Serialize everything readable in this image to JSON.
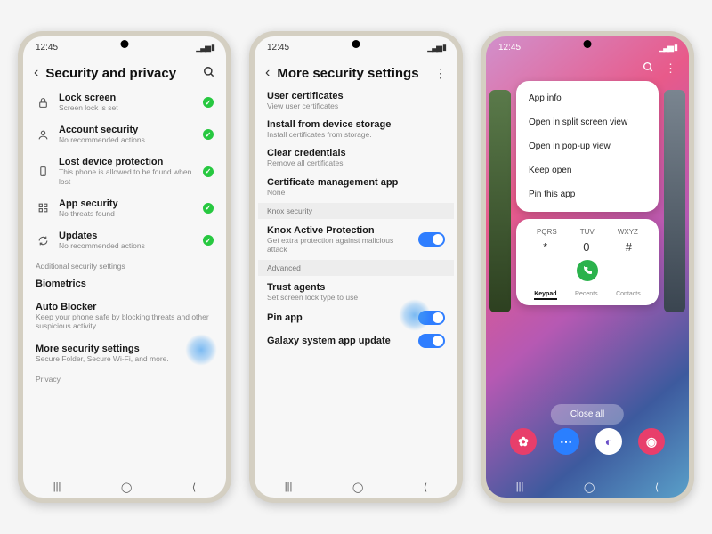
{
  "status": {
    "time": "12:45"
  },
  "phone1": {
    "title": "Security and privacy",
    "items": [
      {
        "icon": "lock",
        "title": "Lock screen",
        "sub": "Screen lock is set",
        "badge": true
      },
      {
        "icon": "user",
        "title": "Account security",
        "sub": "No recommended actions",
        "badge": true
      },
      {
        "icon": "device",
        "title": "Lost device protection",
        "sub": "This phone is allowed to be found when lost",
        "badge": true
      },
      {
        "icon": "grid",
        "title": "App security",
        "sub": "No threats found",
        "badge": true
      },
      {
        "icon": "refresh",
        "title": "Updates",
        "sub": "No recommended actions",
        "badge": true
      }
    ],
    "section_label": "Additional security settings",
    "more": [
      {
        "title": "Biometrics",
        "sub": ""
      },
      {
        "title": "Auto Blocker",
        "sub": "Keep your phone safe by blocking threats and other suspicious activity."
      },
      {
        "title": "More security settings",
        "sub": "Secure Folder, Secure Wi-Fi, and more."
      }
    ],
    "privacy_label": "Privacy"
  },
  "phone2": {
    "title": "More security settings",
    "certs": [
      {
        "title": "User certificates",
        "sub": "View user certificates"
      },
      {
        "title": "Install from device storage",
        "sub": "Install certificates from storage."
      },
      {
        "title": "Clear credentials",
        "sub": "Remove all certificates"
      },
      {
        "title": "Certificate management app",
        "sub": "None"
      }
    ],
    "knox_section": "Knox security",
    "knox": {
      "title": "Knox Active Protection",
      "sub": "Get extra protection against malicious attack"
    },
    "adv_section": "Advanced",
    "adv": [
      {
        "title": "Trust agents",
        "sub": "Set screen lock type to use"
      },
      {
        "title": "Pin app",
        "sub": ""
      },
      {
        "title": "Galaxy system app update",
        "sub": ""
      }
    ]
  },
  "phone3": {
    "menu": [
      "App info",
      "Open in split screen view",
      "Open in pop-up view",
      "Keep open",
      "Pin this app"
    ],
    "dialer": {
      "hints": [
        "PQRS",
        "TUV",
        "WXYZ"
      ],
      "keys": [
        "*",
        "0",
        "#"
      ],
      "tabs": [
        "Keypad",
        "Recents",
        "Contacts"
      ]
    },
    "close_all": "Close all"
  }
}
